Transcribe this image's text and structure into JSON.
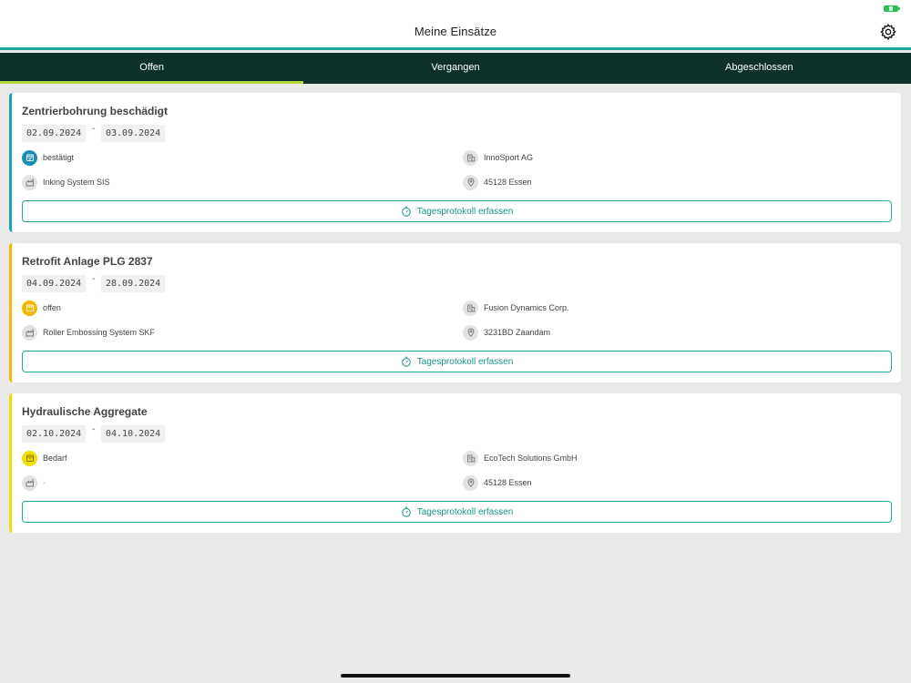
{
  "app": {
    "title": "Meine Einsätze",
    "accent": "#1fa79a",
    "tab_active_indicator": "#b6d642",
    "tabbar_bg": "#0d3129"
  },
  "tabs": [
    {
      "label": "Offen",
      "active": true
    },
    {
      "label": "Vergangen",
      "active": false
    },
    {
      "label": "Abgeschlossen",
      "active": false
    }
  ],
  "cards": [
    {
      "title": "Zentrierbohrung beschädigt",
      "date_from": "02.09.2024",
      "date_to": "03.09.2024",
      "date_separator": "-",
      "status": "bestätigt",
      "status_color": "#1a8db0",
      "status_icon": "calendar-check-icon",
      "machine": "Inking System SIS",
      "machine_icon": "factory-icon",
      "customer": "InnoSport AG",
      "customer_icon": "building-icon",
      "location": "45128 Essen",
      "location_icon": "location-pin-icon",
      "button_label": "Tagesprotokoll erfassen",
      "border_color": "#1aa0c8"
    },
    {
      "title": "Retrofit Anlage PLG 2837",
      "date_from": "04.09.2024",
      "date_to": "28.09.2024",
      "date_separator": "-",
      "status": "offen",
      "status_color": "#f5b800",
      "status_icon": "calendar-icon",
      "machine": "Roller Embossing System SKF",
      "machine_icon": "factory-icon",
      "customer": "Fusion Dynamics Corp.",
      "customer_icon": "building-icon",
      "location": "3231BD Zaandam",
      "location_icon": "location-pin-icon",
      "button_label": "Tagesprotokoll erfassen",
      "border_color": "#f5b800"
    },
    {
      "title": "Hydraulische Aggregate",
      "date_from": "02.10.2024",
      "date_to": "04.10.2024",
      "date_separator": "-",
      "status": "Bedarf",
      "status_color": "#f0e000",
      "status_icon": "calendar-alert-icon",
      "machine": "-",
      "machine_icon": "factory-icon",
      "customer": "EcoTech Solutions GmbH",
      "customer_icon": "building-icon",
      "location": "45128 Essen",
      "location_icon": "location-pin-icon",
      "button_label": "Tagesprotokoll erfassen",
      "border_color": "#f0e000"
    }
  ]
}
